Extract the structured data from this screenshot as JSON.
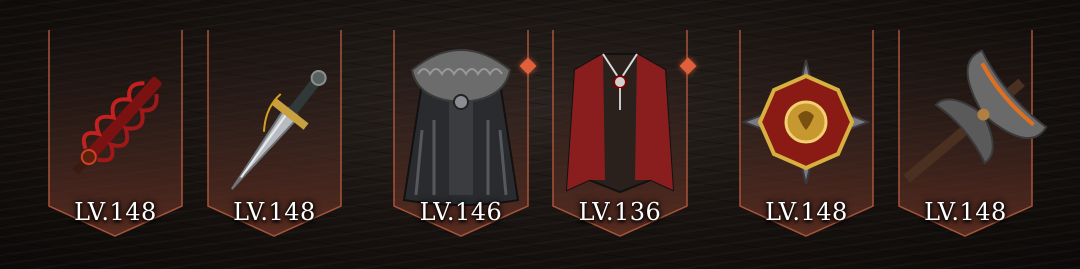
{
  "slots": [
    {
      "name": "crimson-blade",
      "level": "LV.148",
      "upgrade_marker": false
    },
    {
      "name": "steel-greatsword",
      "level": "LV.148",
      "upgrade_marker": false
    },
    {
      "name": "fur-cloak",
      "level": "LV.146",
      "upgrade_marker": true
    },
    {
      "name": "red-robe",
      "level": "LV.136",
      "upgrade_marker": true
    },
    {
      "name": "gold-medal",
      "level": "LV.148",
      "upgrade_marker": false
    },
    {
      "name": "battle-axe",
      "level": "LV.148",
      "upgrade_marker": false
    }
  ],
  "colors": {
    "frame_border": "#a7553a",
    "marker": "#e0603c",
    "label": "#ffffff"
  }
}
